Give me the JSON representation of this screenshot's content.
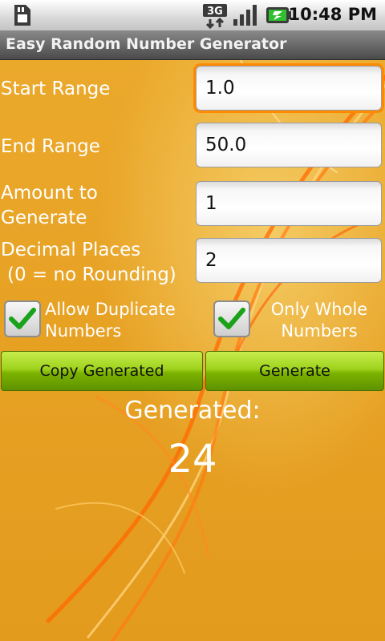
{
  "status_bar": {
    "time": "10:48 PM",
    "network": "3G",
    "icons": [
      "sd-card-icon",
      "network-3g-icon",
      "signal-icon",
      "battery-charging-icon"
    ]
  },
  "app": {
    "title": "Easy Random Number Generator"
  },
  "form": {
    "start_range": {
      "label": "Start Range",
      "value": "1.0"
    },
    "end_range": {
      "label": "End Range",
      "value": "50.0"
    },
    "amount": {
      "label_line1": "Amount to",
      "label_line2": "Generate",
      "value": "1"
    },
    "decimal_places": {
      "label_line1": "Decimal Places",
      "label_line2": "(0 = no Rounding)",
      "value": "2"
    },
    "allow_duplicates": {
      "label_line1": "Allow Duplicate",
      "label_line2": "Numbers",
      "checked": true
    },
    "only_whole": {
      "label_line1": "Only Whole",
      "label_line2": "Numbers",
      "checked": true
    }
  },
  "buttons": {
    "copy": "Copy Generated",
    "generate": "Generate"
  },
  "result": {
    "label": "Generated:",
    "value": "24"
  },
  "colors": {
    "background": "#e8a020",
    "button_green": "#9fd21d",
    "focus_orange": "#ff8a00",
    "check_green": "#1aa31a"
  }
}
